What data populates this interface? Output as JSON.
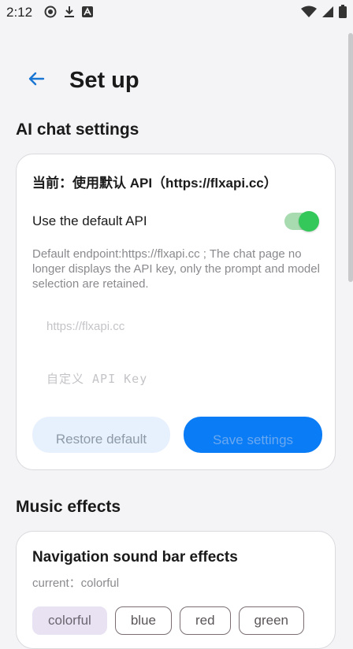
{
  "status_bar": {
    "time": "2:12"
  },
  "header": {
    "title": "Set up"
  },
  "ai_section": {
    "title": "AI chat settings",
    "current_api": "当前：使用默认 API（https://flxapi.cc）",
    "toggle_label": "Use the default API",
    "toggle_on": true,
    "hint": "Default endpoint:https://flxapi.cc ; The chat page no longer displays the API key, only the prompt and model selection are retained.",
    "endpoint_placeholder": "https://flxapi.cc",
    "key_placeholder": "自定义 API Key",
    "restore_label": "Restore default",
    "save_label": "Save settings"
  },
  "music_section": {
    "title": "Music effects",
    "heading": "Navigation sound bar effects",
    "current": "current：colorful",
    "chips": [
      {
        "label": "colorful",
        "selected": true
      },
      {
        "label": "blue",
        "selected": false
      },
      {
        "label": "red",
        "selected": false
      },
      {
        "label": "green",
        "selected": false
      }
    ]
  },
  "colors": {
    "accent": "#0a7cf6",
    "toggle": "#34c759",
    "background": "#f4f4f7"
  }
}
